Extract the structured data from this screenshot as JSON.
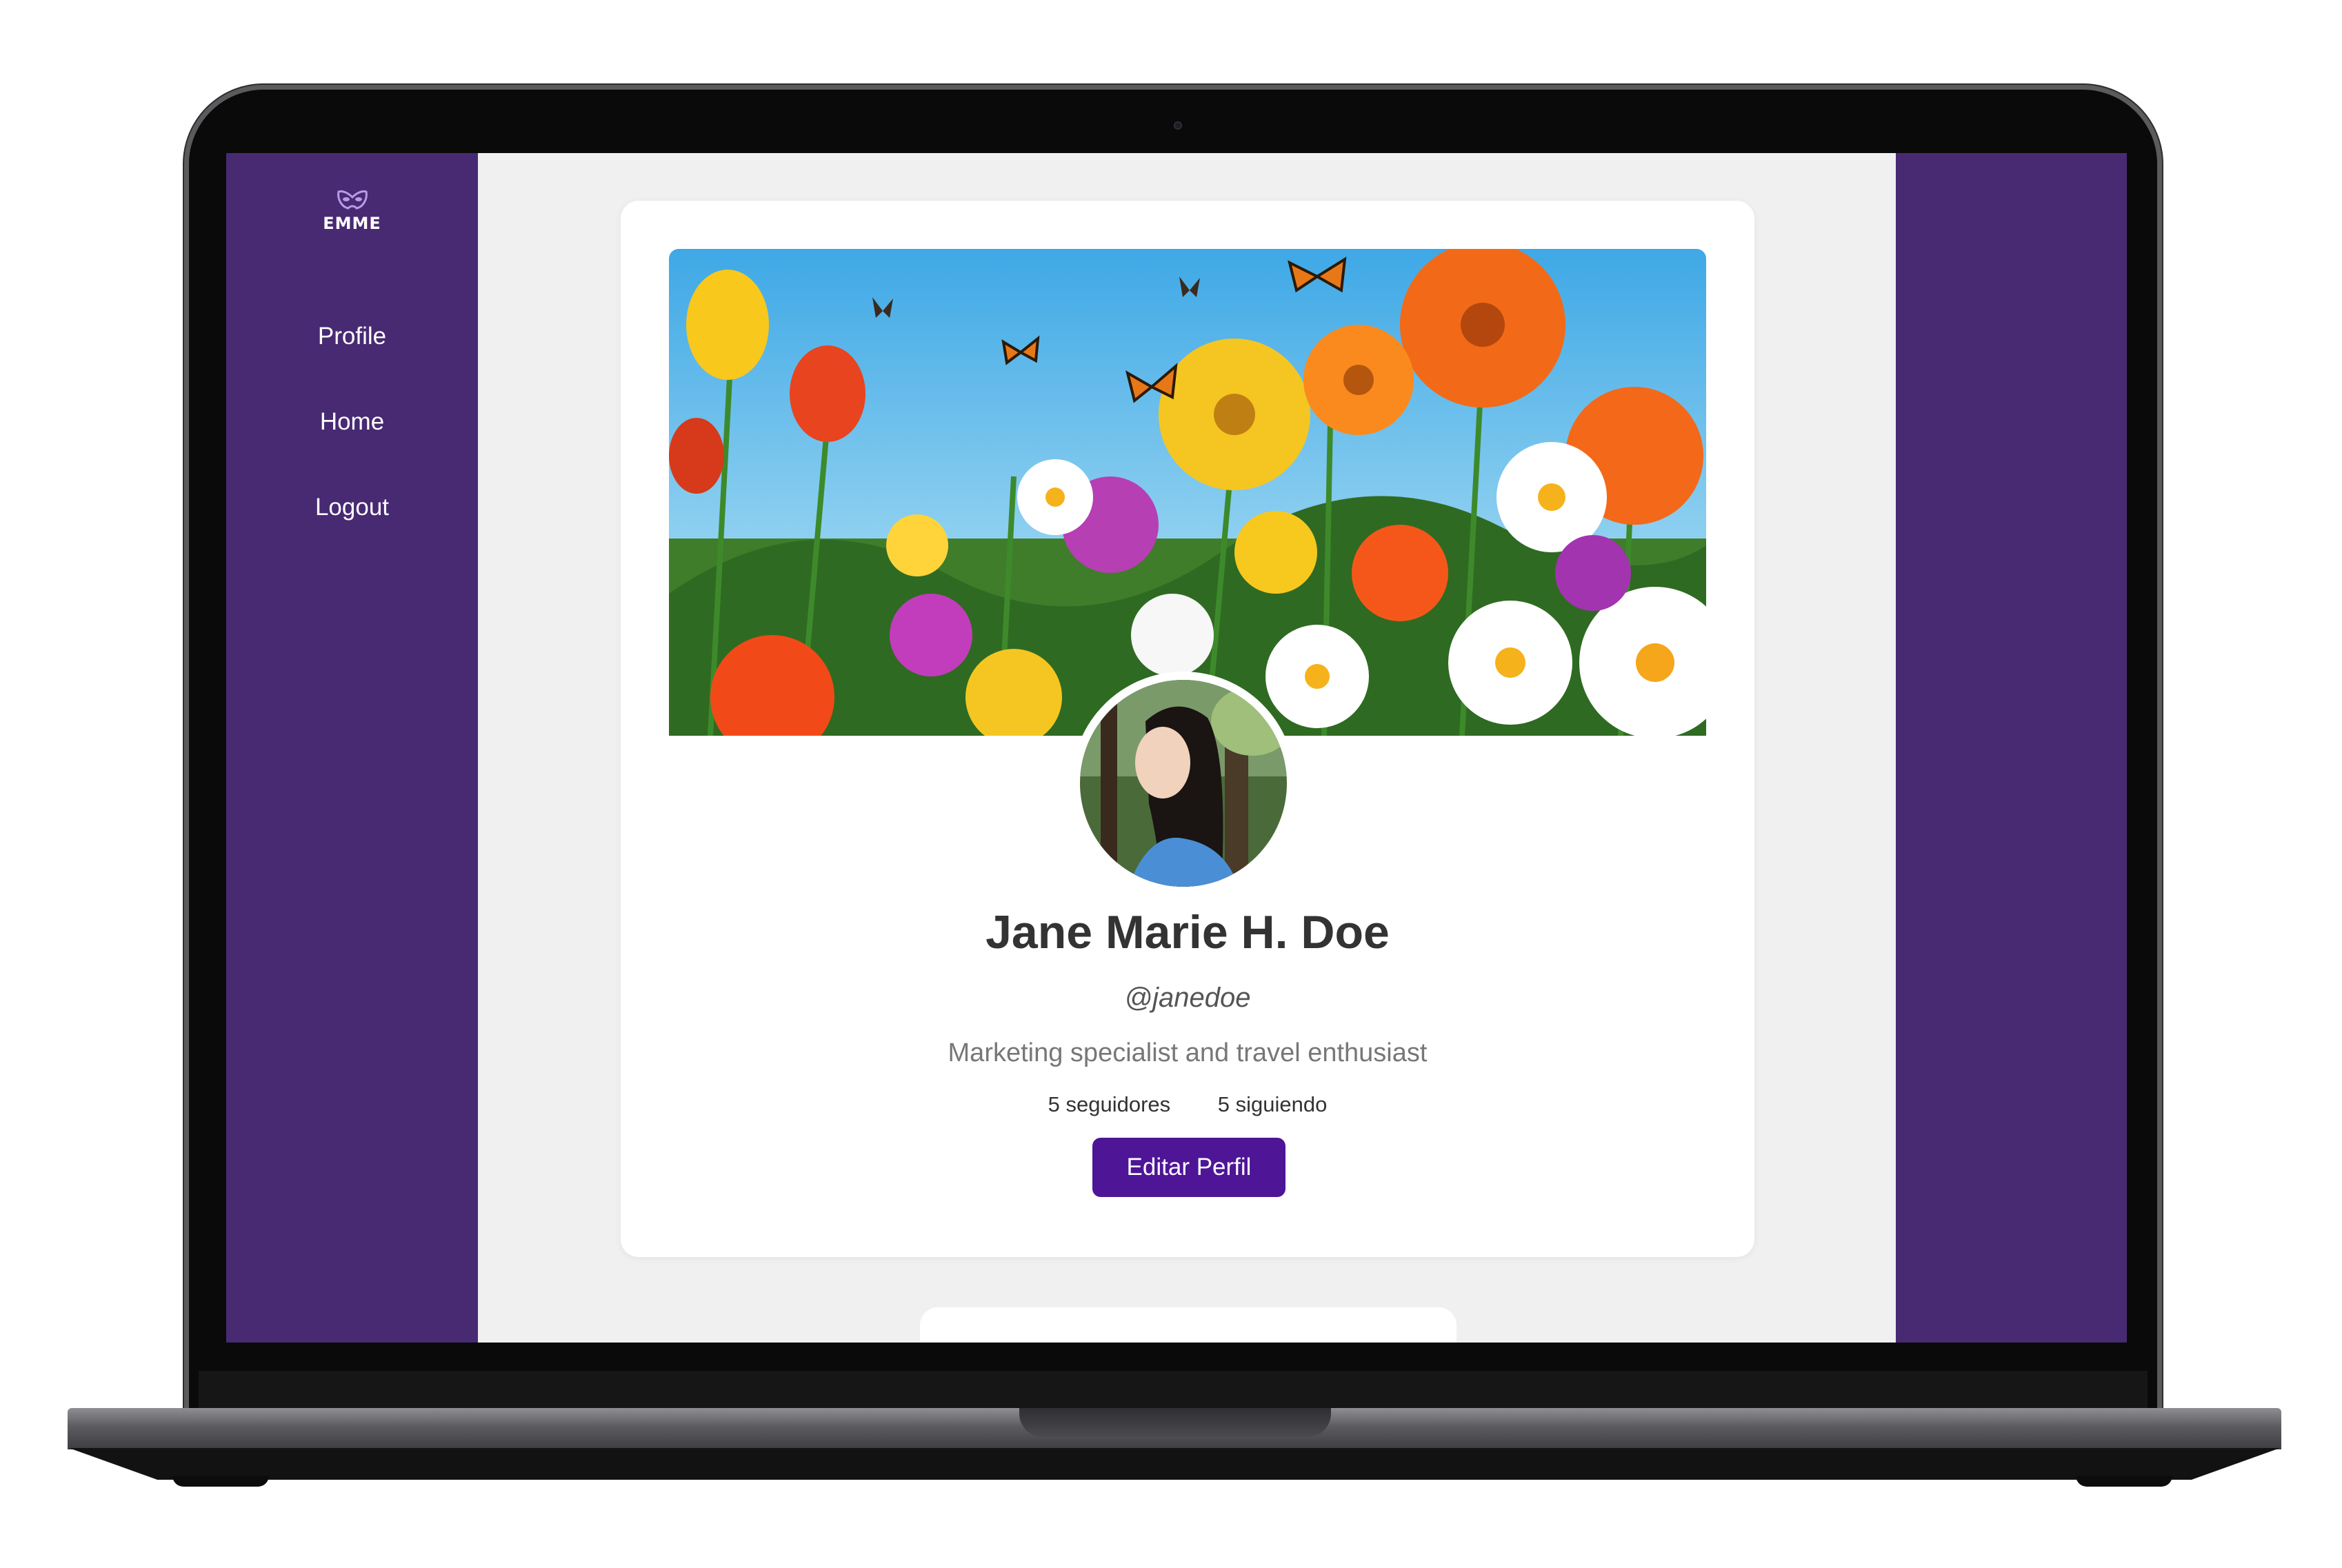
{
  "app": {
    "logo_text": "EMME",
    "logo_icon": "mask-icon"
  },
  "sidebar": {
    "items": [
      {
        "label": "Profile"
      },
      {
        "label": "Home"
      },
      {
        "label": "Logout"
      }
    ]
  },
  "profile": {
    "name": "Jane Marie H. Doe",
    "handle": "@janedoe",
    "bio": "Marketing specialist and travel enthusiast",
    "followers": "5 seguidores",
    "following": "5 siguiendo",
    "edit_label": "Editar Perfil"
  },
  "colors": {
    "sidebar_bg": "#482a73",
    "button_bg": "#4e1596",
    "page_bg": "#f0f0f0"
  }
}
